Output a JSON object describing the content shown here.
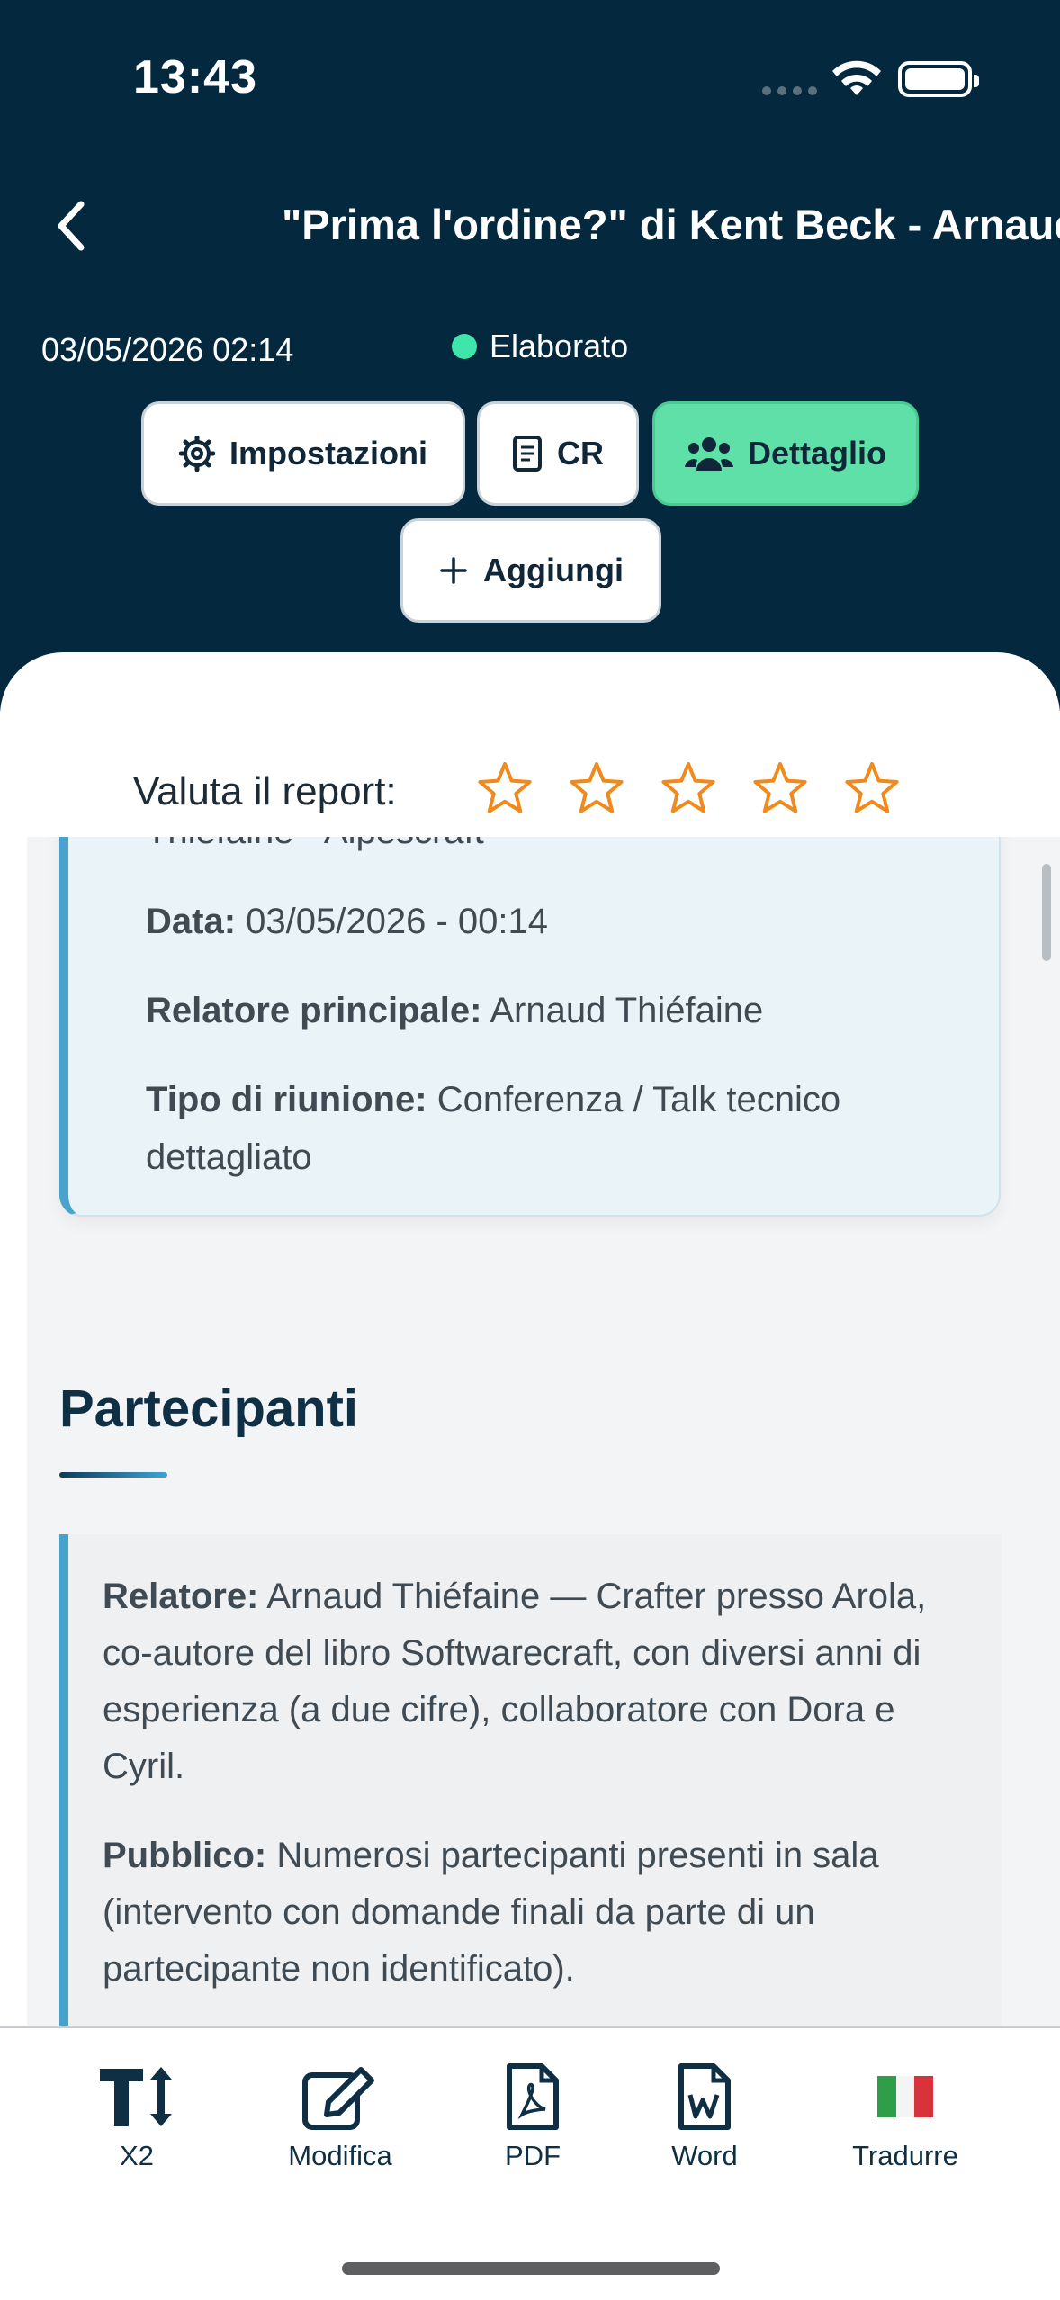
{
  "status_bar": {
    "time": "13:43"
  },
  "header": {
    "title": "\"Prima l'ordine?\" di Kent Beck - Arnaud Thiéfaine - Alpescraft",
    "date": "03/05/2026 02:14",
    "status": "Elaborato",
    "status_color": "#3ee6ac",
    "background_color": "#04293f",
    "buttons": {
      "settings": "Impostazioni",
      "cr": "CR",
      "detail": "Dettaglio",
      "add": "Aggiungi"
    }
  },
  "rating": {
    "label": "Valuta il report:",
    "max_stars": 5,
    "selected_stars": 0,
    "star_color": "#f08a1c"
  },
  "info_card": {
    "title_fragment": "Thiéfaine - Alpescraft",
    "date_label": "Data:",
    "date_value": "03/05/2026 - 00:14",
    "speaker_label": "Relatore principale:",
    "speaker_value": "Arnaud Thiéfaine",
    "meeting_type_label": "Tipo di riunione:",
    "meeting_type_value": "Conferenza / Talk tecnico",
    "meeting_type_value_2": "dettagliato"
  },
  "participants": {
    "title": "Partecipanti",
    "speaker_label": "Relatore:",
    "speaker_lines": [
      "Arnaud Thiéfaine — Crafter presso Arola,",
      "co-autore del libro Softwarecraft, con diversi anni di",
      "esperienza (a due cifre), collaboratore con Dora e",
      "Cyril."
    ],
    "audience_label": "Pubblico:",
    "audience_lines": [
      "Numerosi partecipanti presenti in sala",
      "(intervento con domande finali da parte di un",
      "partecipante non identificato)."
    ]
  },
  "toolbar": {
    "font_size": "X2",
    "edit": "Modifica",
    "pdf": "PDF",
    "word": "Word",
    "translate": "Tradurre"
  }
}
